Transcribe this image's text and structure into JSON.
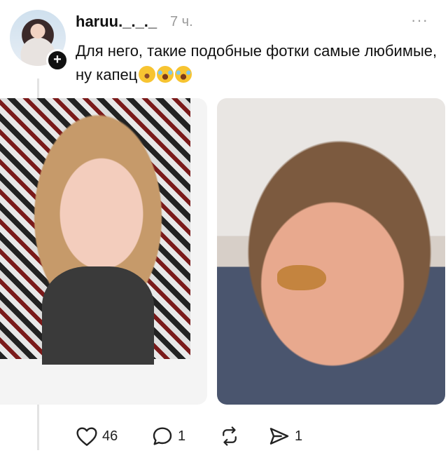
{
  "post": {
    "username": "haruu._._._",
    "timestamp": "7 ч.",
    "text": "Для него, такие подобные фотки самые любимые, ну капец",
    "emojis": [
      "loudly-crying-face",
      "face-with-tears-of-joy",
      "face-with-tears-of-joy"
    ],
    "more_icon": "···"
  },
  "avatar": {
    "icon": "profile-avatar",
    "badge": "+"
  },
  "media": [
    {
      "name": "photo-1",
      "description_icon": "image"
    },
    {
      "name": "photo-2",
      "description_icon": "image"
    }
  ],
  "actions": {
    "like_count": "46",
    "reply_count": "1",
    "repost_count": "",
    "share_count": "1"
  },
  "colors": {
    "text": "#111111",
    "muted": "#9a9a9a",
    "thread_line": "#e3e3e3",
    "background": "#ffffff"
  }
}
